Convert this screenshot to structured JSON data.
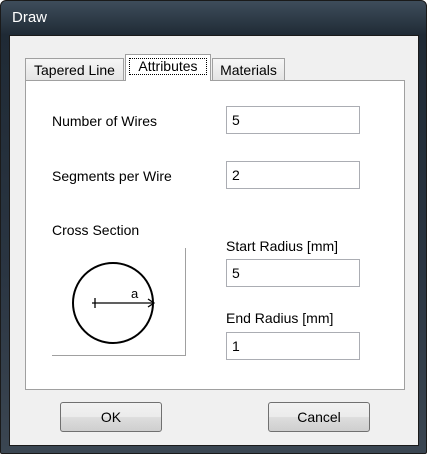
{
  "window": {
    "title": "Draw"
  },
  "tabs": [
    {
      "label": "Tapered Line",
      "active": false
    },
    {
      "label": "Attributes",
      "active": true
    },
    {
      "label": "Materials",
      "active": false
    }
  ],
  "attributes": {
    "number_of_wires_label": "Number of Wires",
    "number_of_wires_value": "5",
    "segments_per_wire_label": "Segments per Wire",
    "segments_per_wire_value": "2",
    "cross_section_label": "Cross Section",
    "cross_section_diagram_label": "a",
    "start_radius_label": "Start Radius  [mm]",
    "start_radius_value": "5",
    "end_radius_label": "End Radius  [mm]",
    "end_radius_value": "1"
  },
  "buttons": {
    "ok": "OK",
    "cancel": "Cancel"
  }
}
